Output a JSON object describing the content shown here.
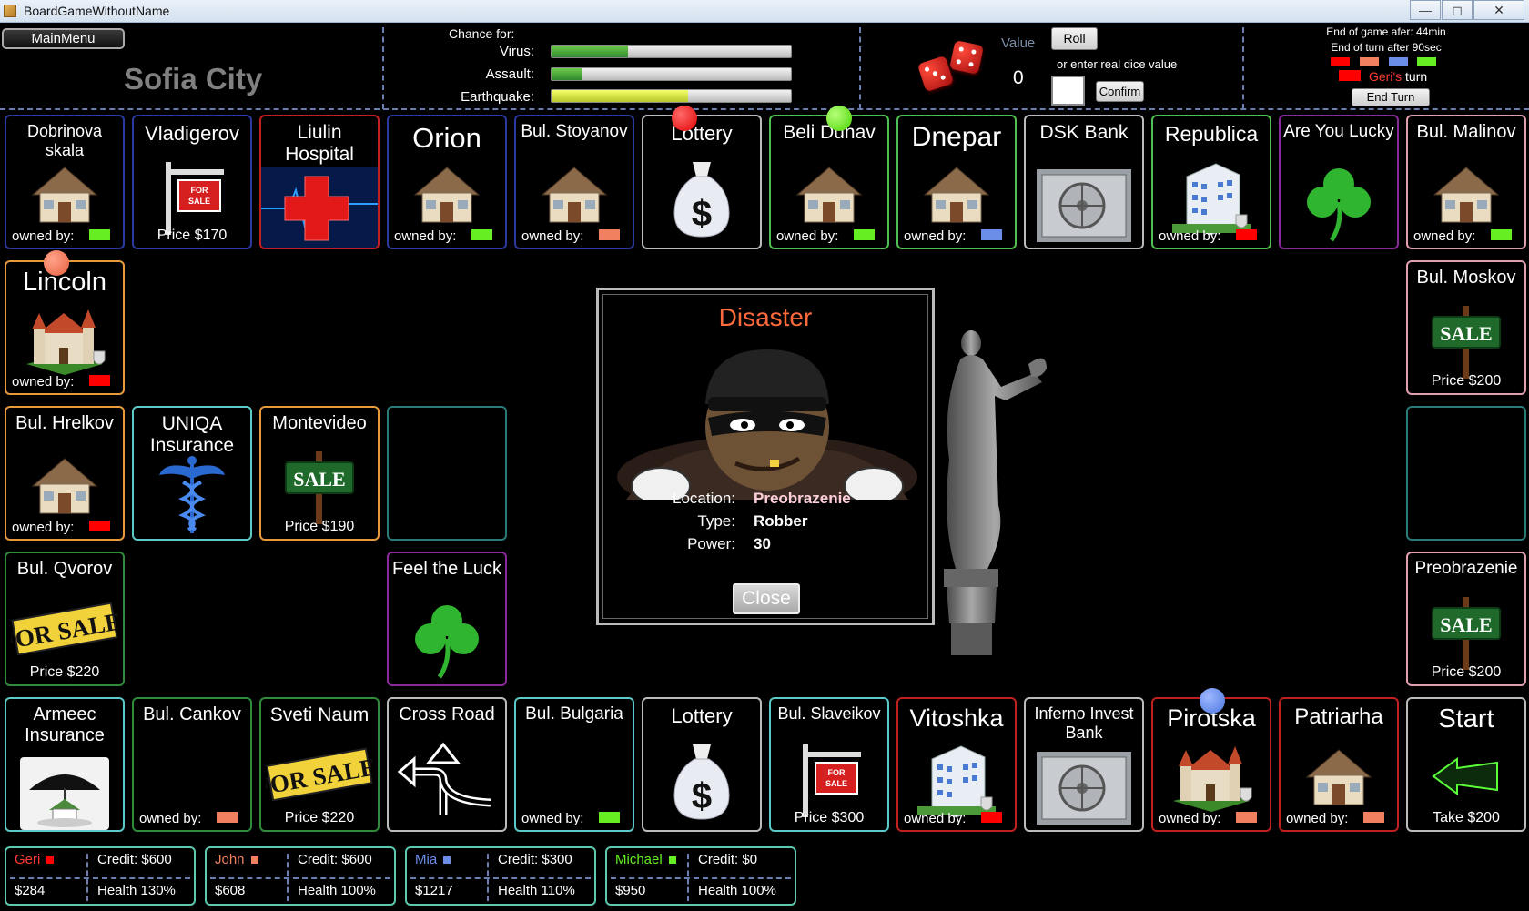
{
  "window": {
    "title": "BoardGameWithoutName",
    "min": "—",
    "max": "◻",
    "close": "✕"
  },
  "hud": {
    "main_menu": "MainMenu",
    "city": "Sofia City",
    "chance_title": "Chance for:",
    "chances": [
      {
        "label": "Virus:",
        "level": 0.32,
        "color": "#6ecb4a"
      },
      {
        "label": "Assault:",
        "level": 0.13,
        "color": "#6ecb4a"
      },
      {
        "label": "Earthquake:",
        "level": 0.57,
        "color": "#d8ea3a"
      }
    ],
    "value_label": "Value",
    "value": "0",
    "roll": "Roll",
    "enter_label": "or enter real dice value",
    "confirm": "Confirm",
    "end_game": "End of game afer: 44min",
    "end_turn": "End of turn after 90sec",
    "player_colors": [
      "#ff0000",
      "#f08060",
      "#6a8ee8",
      "#66ee22"
    ],
    "turn_name": "Geri's",
    "turn_suffix": " turn",
    "end_turn_btn": "End Turn"
  },
  "labels": {
    "owned_by": "owned by:"
  },
  "tiles": [
    {
      "name": "Dobrinova skala",
      "icon": "house-icon",
      "owner_color": "#66ee22",
      "border": "#2a3aa0"
    },
    {
      "name": "Vladigerov",
      "icon": "for-sale-sign-icon",
      "price": "Price $170",
      "border": "#2a3aa0"
    },
    {
      "name": "Liulin Hospital",
      "icon": "red-cross-icon",
      "border": "#c02020"
    },
    {
      "name": "Orion",
      "icon": "house-icon",
      "owner_color": "#66ee22",
      "border": "#2a3aa0"
    },
    {
      "name": "Bul. Stoyanov",
      "icon": "house-icon",
      "owner_color": "#f08060",
      "border": "#2a3aa0"
    },
    {
      "name": "Lottery",
      "icon": "money-bag-icon",
      "border": "#bbbbbb"
    },
    {
      "name": "Beli Dunav",
      "icon": "house-icon",
      "owner_color": "#66ee22",
      "border": "#4fbf4f"
    },
    {
      "name": "Dnepar",
      "icon": "house-icon",
      "owner_color": "#6a8ee8",
      "border": "#4fbf4f"
    },
    {
      "name": "DSK Bank",
      "icon": "vault-icon",
      "border": "#bbbbbb"
    },
    {
      "name": "Republica",
      "icon": "building-icon",
      "owner_color": "#ff0000",
      "border": "#4fbf4f"
    },
    {
      "name": "Are You Lucky",
      "icon": "clover-icon",
      "border": "#8a2a9a"
    },
    {
      "name": "Bul. Malinov",
      "icon": "house-icon",
      "owner_color": "#66ee22",
      "border": "#e0a0b0"
    },
    {
      "name": "Lincoln",
      "icon": "castle-icon",
      "owner_color": "#ff0000",
      "border": "#e89a3a"
    },
    {
      "name": "Bul. Moskov",
      "icon": "sale-sign-icon",
      "price": "Price $200",
      "border": "#e0a0b0"
    },
    {
      "name": "Bul. Hrelkov",
      "icon": "house-icon",
      "owner_color": "#ff0000",
      "border": "#e89a3a"
    },
    {
      "name": "UNIQA Insurance",
      "icon": "caduceus-icon",
      "border": "#5cc9c9"
    },
    {
      "name": "Montevideo",
      "icon": "sale-sign-icon",
      "price": "Price $190",
      "border": "#e89a3a"
    },
    {
      "name": "",
      "icon": "",
      "border": "#2a7a7a"
    },
    {
      "name": "",
      "icon": "",
      "border": "#2a7a7a"
    },
    {
      "name": "Bul. Qvorov",
      "icon": "for-sale-banner-icon",
      "price": "Price $220",
      "border": "#2f8a3a"
    },
    {
      "name": "Feel the Luck",
      "icon": "clover-icon",
      "border": "#8a2a9a"
    },
    {
      "name": "Preobrazenie",
      "icon": "sale-sign-icon",
      "price": "Price $200",
      "border": "#e0a0b0"
    },
    {
      "name": "Armeec Insurance",
      "icon": "umbrella-house-icon",
      "border": "#5cc9c9"
    },
    {
      "name": "Bul. Cankov",
      "icon": "",
      "owner_color": "#f08060",
      "border": "#2f8a3a"
    },
    {
      "name": "Sveti Naum",
      "icon": "for-sale-banner-icon",
      "price": "Price $220",
      "border": "#2f8a3a"
    },
    {
      "name": "Cross Road",
      "icon": "cross-road-arrow-icon",
      "border": "#bbbbbb"
    },
    {
      "name": "Bul. Bulgaria",
      "icon": "",
      "owner_color": "#66ee22",
      "border": "#5cc9c9"
    },
    {
      "name": "Lottery",
      "icon": "money-bag-icon",
      "border": "#bbbbbb"
    },
    {
      "name": "Bul. Slaveikov",
      "icon": "for-sale-sign-icon",
      "price": "Price $300",
      "border": "#5cc9c9"
    },
    {
      "name": "Vitoshka",
      "icon": "building-icon",
      "owner_color": "#ff0000",
      "border": "#c02020"
    },
    {
      "name": "Inferno Invest Bank",
      "icon": "vault-icon",
      "border": "#bbbbbb"
    },
    {
      "name": "Pirotska",
      "icon": "castle-icon",
      "owner_color": "#f08060",
      "border": "#c02020"
    },
    {
      "name": "Patriarha",
      "icon": "house-icon",
      "owner_color": "#f08060",
      "border": "#c02020"
    },
    {
      "name": "Start",
      "icon": "green-arrow-icon",
      "price": "Take $200",
      "border": "#bbbbbb"
    }
  ],
  "popup": {
    "title": "Disaster",
    "location_label": "Location:",
    "location": "Preobrazenie",
    "type_label": "Type:",
    "type": "Robber",
    "power_label": "Power:",
    "power": "30",
    "close": "Close",
    "image": "robber-icon"
  },
  "statue": "statue-icon",
  "players": [
    {
      "name": "Geri",
      "color": "#ff0000",
      "money": "$284",
      "credit": "Credit: $600",
      "health": "Health  130%",
      "name_color": "#ff3b2f"
    },
    {
      "name": "John",
      "color": "#f08060",
      "money": "$608",
      "credit": "Credit: $600",
      "health": "Health  100%",
      "name_color": "#f08060"
    },
    {
      "name": "Mia",
      "color": "#6a8ee8",
      "money": "$1217",
      "credit": "Credit: $300",
      "health": "Health  110%",
      "name_color": "#6a8ee8"
    },
    {
      "name": "Michael",
      "color": "#66ee22",
      "money": "$950",
      "credit": "Credit: $0",
      "health": "Health  100%",
      "name_color": "#66ee22"
    }
  ]
}
